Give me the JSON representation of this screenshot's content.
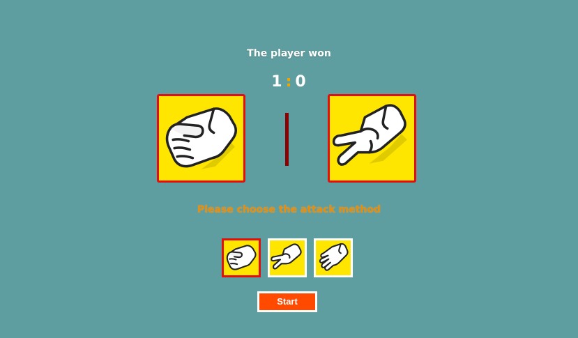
{
  "result_text": "The player won",
  "score": {
    "player": "1",
    "separator": ":",
    "computer": "0"
  },
  "player_hand": "rock-icon",
  "computer_hand": "scissors-icon",
  "prompt": "Please choose the attack method",
  "choices": [
    {
      "name": "rock",
      "icon": "rock-icon",
      "selected": true
    },
    {
      "name": "scissors",
      "icon": "scissors-icon",
      "selected": false
    },
    {
      "name": "paper",
      "icon": "paper-icon",
      "selected": false
    }
  ],
  "start_label": "Start",
  "colors": {
    "background": "#5f9ea0",
    "card_fill": "#ffe600",
    "card_border": "#e01010",
    "score_separator": "#f0a500",
    "prompt_text": "#f08a00",
    "start_button": "#ff4a00",
    "divider": "#8b0000"
  }
}
